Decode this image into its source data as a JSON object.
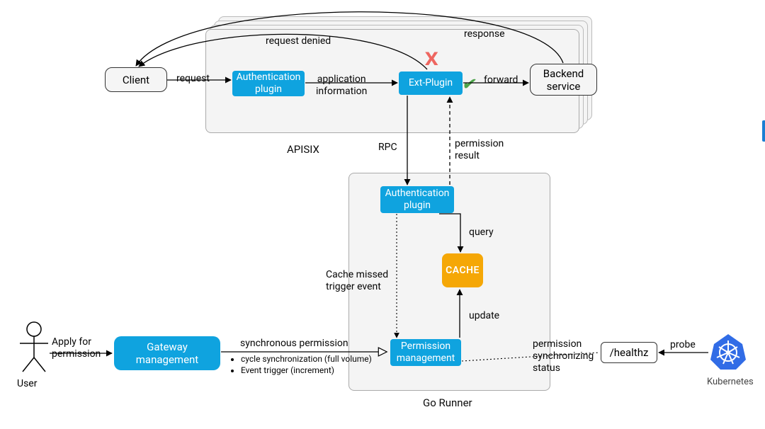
{
  "regions": {
    "apisix_label": "APISIX",
    "go_runner_label": "Go Runner"
  },
  "nodes": {
    "client": "Client",
    "auth_plugin_top": "Authentication\nplugin",
    "ext_plugin": "Ext-Plugin",
    "backend": "Backend\nservice",
    "auth_plugin_bottom": "Authentication\nplugin",
    "cache": "CACHE",
    "permission_mgmt": "Permission\nmanagement",
    "gateway_mgmt": "Gateway\nmanagement",
    "healthz": "/healthz",
    "kubernetes_label": "Kubernetes",
    "user_label": "User"
  },
  "edges": {
    "request": "request",
    "app_info": "application\ninformation",
    "forward": "forward",
    "response": "response",
    "request_denied": "request denied",
    "rpc": "RPC",
    "permission_result": "permission\nresult",
    "query": "query",
    "cache_missed": "Cache missed\ntrigger event",
    "update": "update",
    "apply_permission": "Apply for\npermission",
    "sync_permission": "synchronous permission",
    "perm_sync_status": "permission\nsynchronizing\nstatus",
    "probe": "probe"
  },
  "notes": {
    "sync_modes": [
      "cycle synchronization (full volume)",
      "Event trigger (increment)"
    ]
  },
  "markers": {
    "x": "X",
    "check": "✔"
  }
}
